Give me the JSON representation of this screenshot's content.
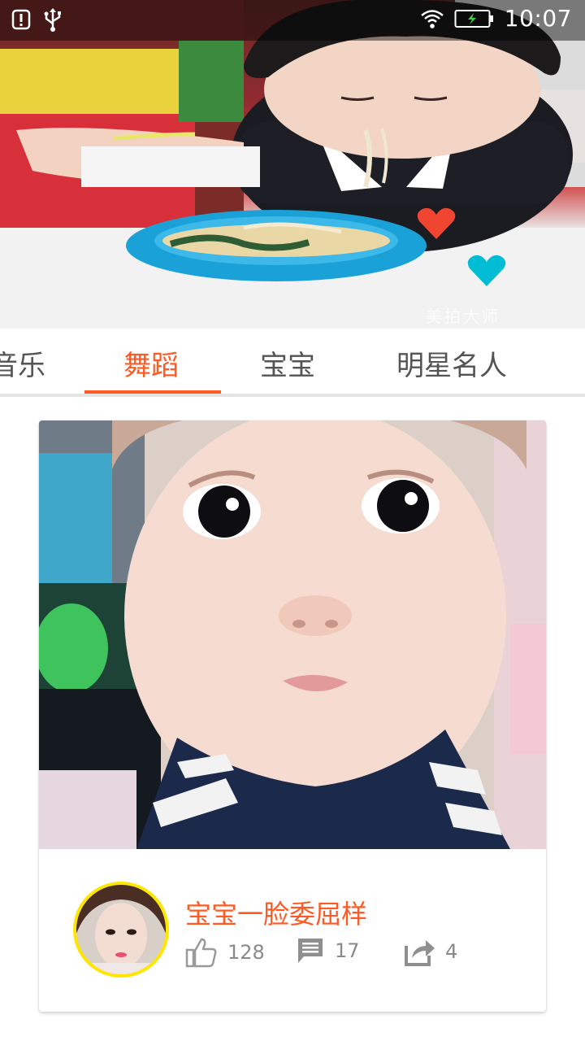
{
  "status_bar": {
    "time": "10:07",
    "icons": [
      "alert-icon",
      "usb-icon",
      "wifi-icon",
      "battery-charging-icon"
    ]
  },
  "hero": {
    "watermark": "美拍大师"
  },
  "tabs": [
    {
      "label": "音乐",
      "active": false
    },
    {
      "label": "舞蹈",
      "active": true
    },
    {
      "label": "宝宝",
      "active": false
    },
    {
      "label": "明星名人",
      "active": false
    }
  ],
  "card": {
    "title": "宝宝一脸委屈样",
    "likes": "128",
    "comments": "17",
    "shares": "4"
  },
  "colors": {
    "accent": "#ff5a24",
    "avatar_ring": "#ffe600",
    "heart_red": "#f04530",
    "heart_cyan": "#00bcd4"
  }
}
